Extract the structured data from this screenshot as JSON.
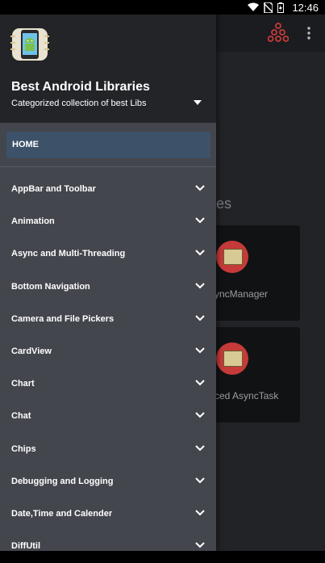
{
  "status_bar": {
    "time": "12:46"
  },
  "drawer": {
    "app_name": "Best Android Libraries",
    "subtitle": "Categorized collection of best Libs",
    "home_label": "HOME",
    "menu_items": [
      "AppBar and Toolbar",
      "Animation",
      "Async and Multi-Threading",
      "Bottom Navigation",
      "Camera and File Pickers",
      "CardView",
      "Chart",
      "Chat",
      "Chips",
      "Debugging and Logging",
      "Date,Time and Calender",
      "DiffUtil"
    ]
  },
  "background": {
    "section_title_fragment": "es",
    "cards": [
      {
        "title_fragment": "yncManager"
      },
      {
        "title_fragment": "ced AsyncTask"
      }
    ]
  },
  "colors": {
    "drawer_bg": "#44464d",
    "drawer_header_bg": "#232428",
    "home_highlight": "#3d5169",
    "app_bg": "#222326",
    "accent_red": "#c63a3a"
  }
}
